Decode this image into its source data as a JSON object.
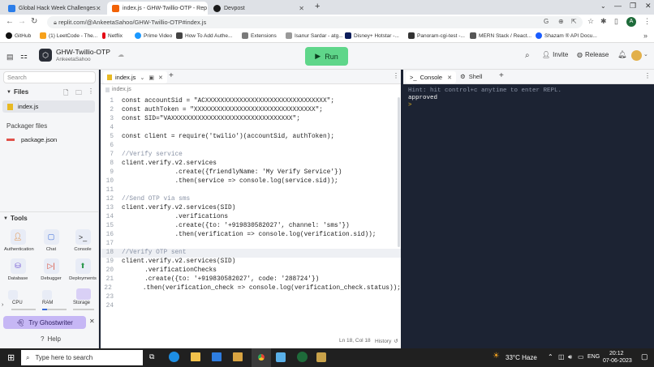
{
  "browser": {
    "tabs": [
      {
        "title": "Global Hack Week Challenges",
        "color": "#2b7de9"
      },
      {
        "title": "index.js - GHW-Twillio-OTP - Rep",
        "color": "#f26207"
      },
      {
        "title": "Devpost",
        "color": "#1a1a1a"
      }
    ],
    "url": "replit.com/@AnkeetaSahoo/GHW-Twillio-OTP#index.js",
    "bookmarks": [
      "GitHub",
      "(1) LeetCode - The...",
      "Netflix",
      "Prime Video",
      "How To Add Authe...",
      "Extensions",
      "Isanur Sardar - atg...",
      "Disney+ Hotstar -...",
      "Panoram-cgi-test -...",
      "MERN Stack / React...",
      "Shazam ® API Docu..."
    ],
    "avatar_letter": "A"
  },
  "repl": {
    "name": "GHW-Twillio-OTP",
    "owner": "AnkeetaSahoo",
    "run_label": "Run",
    "invite_label": "Invite",
    "release_label": "Release"
  },
  "sidebar": {
    "search_placeholder": "Search",
    "files_title": "Files",
    "files": [
      "index.js"
    ],
    "packager_title": "Packager files",
    "packager_files": [
      "package.json"
    ],
    "tools_title": "Tools",
    "tools": [
      "Authentication",
      "Chat",
      "Console",
      "Database",
      "Debugger",
      "Deployments"
    ],
    "resources": [
      "CPU",
      "RAM",
      "Storage"
    ],
    "ghostwriter_label": "Try Ghostwriter",
    "help_label": "Help"
  },
  "editor": {
    "tab_label": "index.js",
    "breadcrumb": "index.js",
    "status": "Ln 18, Col 18",
    "history_label": "History",
    "lines": [
      "const accountSid = \"ACXXXXXXXXXXXXXXXXXXXXXXXXXXXXXXXX\";",
      "const authToken = \"XXXXXXXXXXXXXXXXXXXXXXXXXXXXXXXX\";",
      "const SID=\"VAXXXXXXXXXXXXXXXXXXXXXXXXXXXXXXXX\";",
      "",
      "const client = require('twilio')(accountSid, authToken);",
      "",
      "//Verify service",
      "client.verify.v2.services",
      "              .create({friendlyName: 'My Verify Service'})",
      "              .then(service => console.log(service.sid));",
      "",
      "//Send OTP via sms",
      "client.verify.v2.services(SID)",
      "              .verifications",
      "              .create({to: '+919830582027', channel: 'sms'})",
      "              .then(verification => console.log(verification.sid));",
      "",
      "//Verify OTP sent",
      "client.verify.v2.services(SID)",
      "      .verificationChecks",
      "      .create({to: '+919830582027', code: '288724'})",
      "      .then(verification_check => console.log(verification_check.status));",
      "",
      ""
    ]
  },
  "console": {
    "tabs": [
      "Console",
      "Shell"
    ],
    "hint": "Hint: hit control+c anytime to enter REPL.",
    "output": "approved",
    "prompt": ">"
  },
  "taskbar": {
    "search_placeholder": "Type here to search",
    "weather": "33°C  Haze",
    "lang": "ENG",
    "time": "20:12",
    "date": "07-06-2023"
  }
}
